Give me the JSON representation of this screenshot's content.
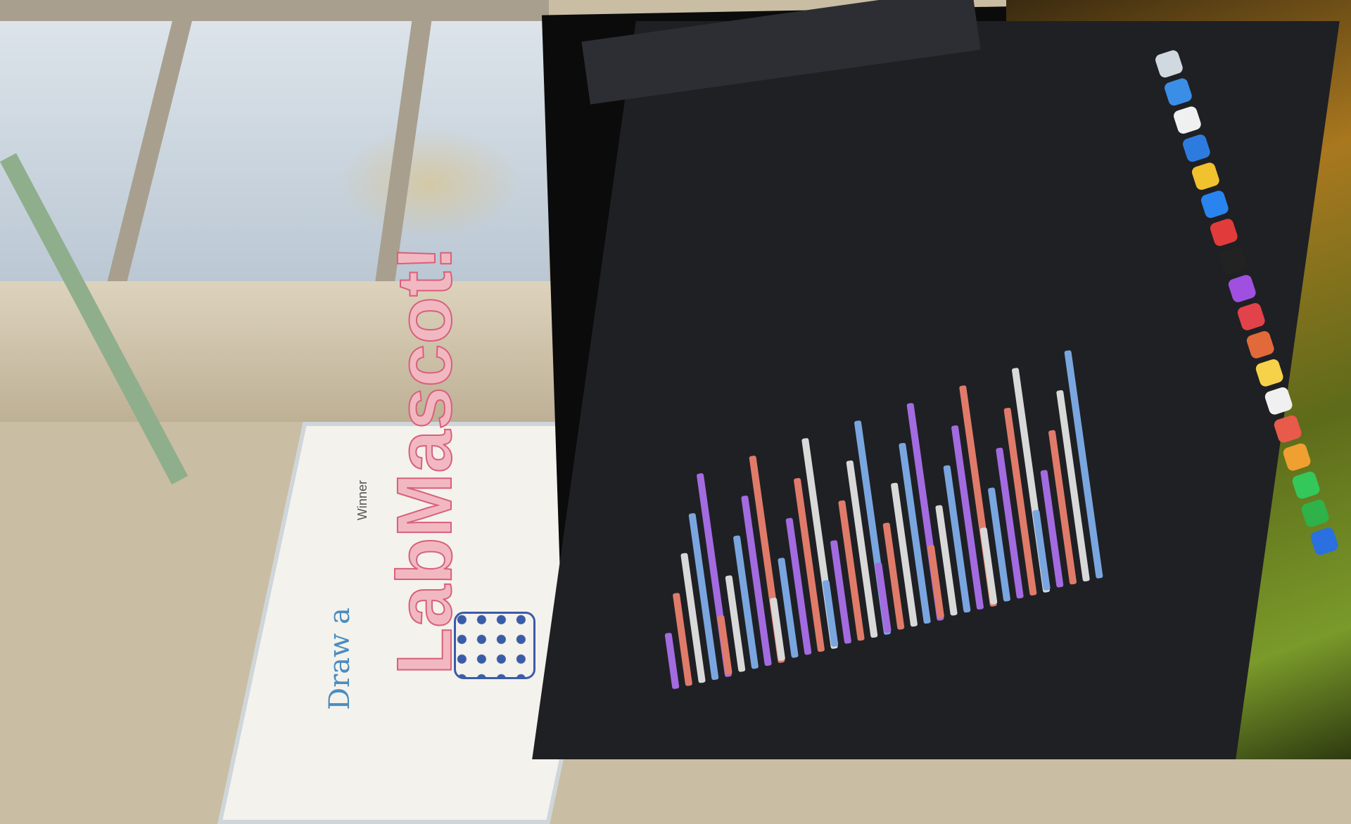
{
  "scene": {
    "whiteboard": {
      "line1": "Draw a",
      "title": "LabMascot!",
      "label": "Winner"
    },
    "monitor": {
      "content": "code-editor",
      "code_colors": [
        "#a36be0",
        "#e07b6a",
        "#d9d9d9",
        "#7aa6e0"
      ]
    },
    "dock_icon_colors": [
      "#d0d8e0",
      "#3a8ee6",
      "#f0f0f0",
      "#2e7be0",
      "#f2c12e",
      "#2a84f0",
      "#e23b3b",
      "#222",
      "#a050e0",
      "#e2424a",
      "#e26a3a",
      "#f5d24a",
      "#f0f0f0",
      "#e85a4a",
      "#f0a030",
      "#34c759",
      "#2fb24a",
      "#2a70e0"
    ]
  }
}
